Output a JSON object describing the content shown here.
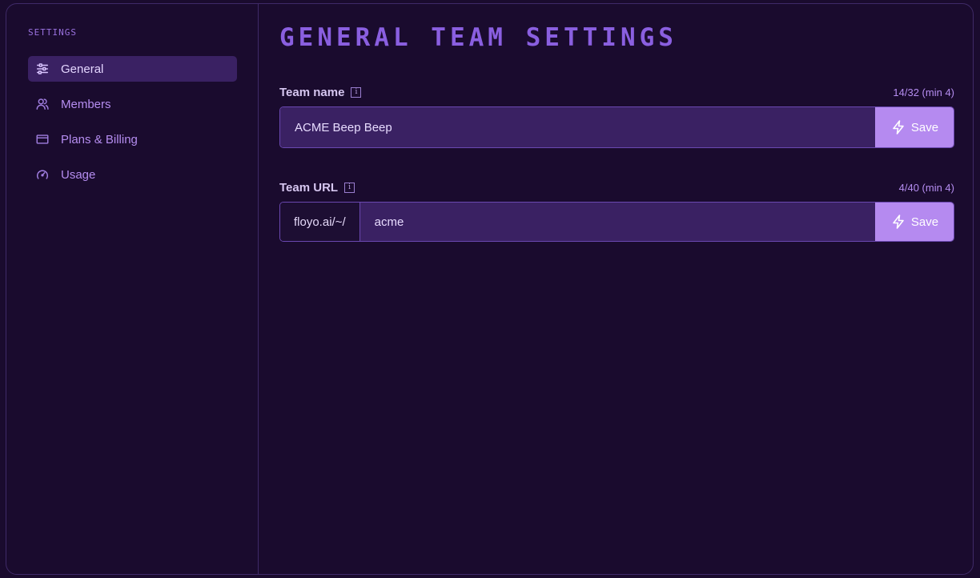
{
  "sidebar": {
    "heading": "SETTINGS",
    "items": [
      {
        "label": "General",
        "icon": "sliders-icon",
        "active": true
      },
      {
        "label": "Members",
        "icon": "users-icon",
        "active": false
      },
      {
        "label": "Plans & Billing",
        "icon": "credit-card-icon",
        "active": false
      },
      {
        "label": "Usage",
        "icon": "gauge-icon",
        "active": false
      }
    ]
  },
  "main": {
    "title": "GENERAL TEAM SETTINGS",
    "team_name": {
      "label": "Team name",
      "counter": "14/32 (min 4)",
      "value": "ACME Beep Beep",
      "save_label": "Save"
    },
    "team_url": {
      "label": "Team URL",
      "counter": "4/40 (min 4)",
      "prefix": "floyo.ai/~/",
      "value": "acme",
      "save_label": "Save"
    }
  },
  "colors": {
    "background": "#1a0b2e",
    "accent": "#b58af0",
    "title": "#8a5fe0",
    "active_nav": "#3a2163"
  }
}
